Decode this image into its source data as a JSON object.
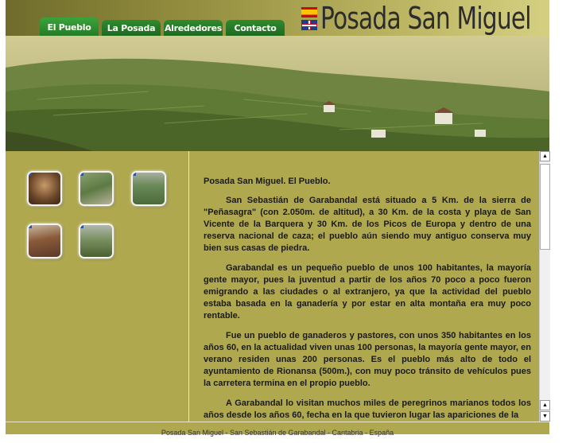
{
  "nav": {
    "tabs": [
      {
        "label": "El Pueblo",
        "active": true
      },
      {
        "label": "La Posada",
        "active": false
      },
      {
        "label": "Alrededores",
        "active": false
      },
      {
        "label": "Contacto",
        "active": false
      }
    ]
  },
  "header": {
    "title": "Posada San Miguel",
    "flags": [
      "flag-spain-icon",
      "flag-uk-icon"
    ]
  },
  "colors": {
    "background": "#afa84e",
    "tab_green": "#267c26",
    "text": "#1a1a1a"
  },
  "gallery": {
    "thumbnails": [
      "church-interior",
      "stone-path",
      "village-view",
      "house-roof",
      "mountain-valley"
    ]
  },
  "content": {
    "heading": "Posada San Miguel. El Pueblo.",
    "paragraphs": [
      "San Sebastián de Garabandal está situado a 5 Km. de la sierra de \"Peñasagra\" (con 2.050m. de altitud), a 30 Km. de la costa y playa de San Vicente de la Barquera y 30 Km. de los Picos de Europa y dentro de una reserva nacional de caza; el pueblo aún siendo muy antiguo conserva muy bien sus casas de piedra.",
      "Garabandal es un pequeño pueblo de unos 100 habitantes, la mayoría gente mayor, pues la juventud a partir de los años 70 poco a poco fueron emigrando a las ciudades o al extranjero, ya que la actividad del pueblo estaba basada en la ganadería y por estar en alta montaña era muy poco rentable.",
      "Fue un pueblo de ganaderos y pastores, con unos 350 habitantes en los años 60, en la actualidad viven unas 100 personas, la mayoría gente mayor, en verano residen unas 200 personas. Es el pueblo más alto de todo el ayuntamiento de Rionansa (500m.), con muy poco tránsito de vehículos pues la carretera termina en el propio pueblo.",
      "A Garabandal lo visitan muchos miles de peregrinos marianos todos los años desde los años 60, fecha en la que tuvieron lugar las apariciones de la"
    ]
  },
  "footer": {
    "text": "Posada San Miguel - San Sebastián de Garabandal - Cantabria - España"
  }
}
